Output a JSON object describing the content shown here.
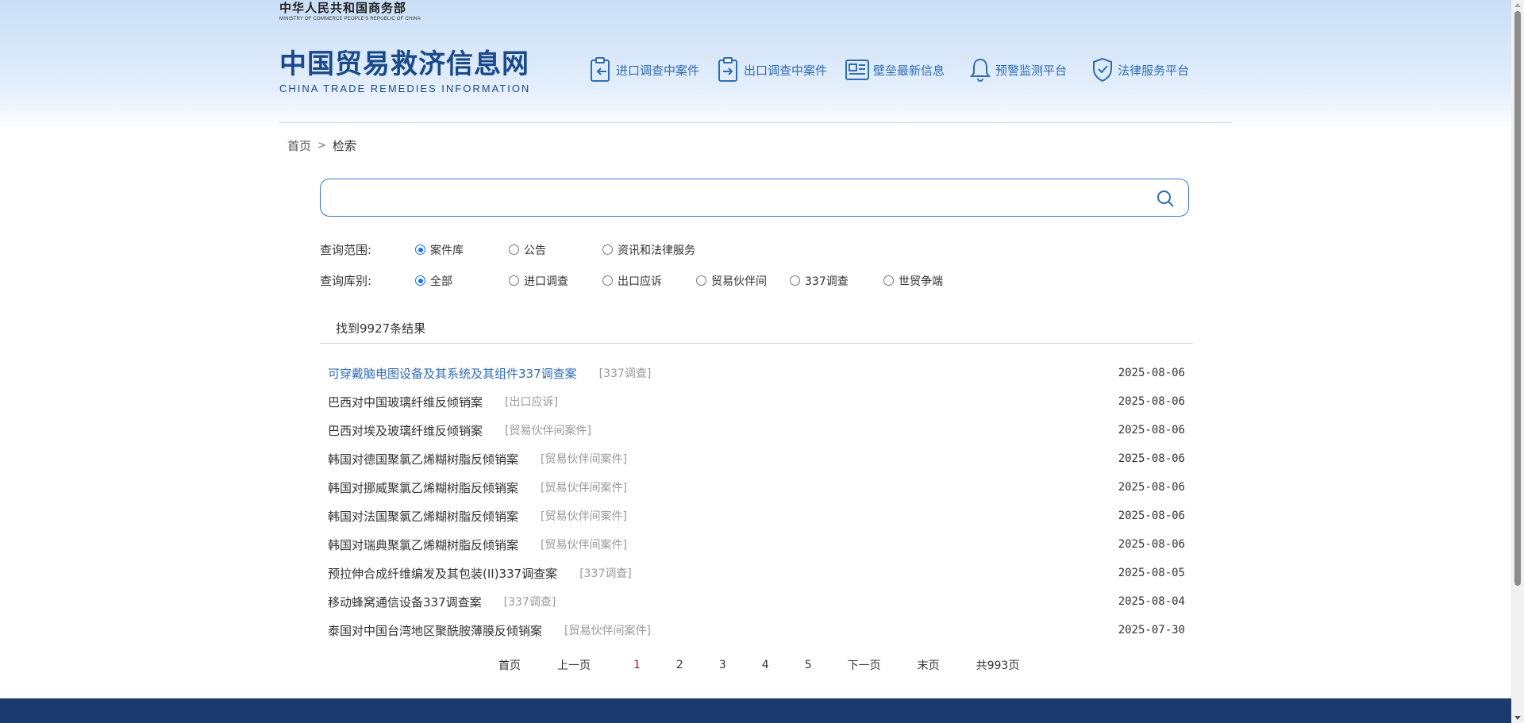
{
  "header": {
    "ministry_cn": "中华人民共和国商务部",
    "ministry_en": "MINISTRY OF COMMERCE PEOPLE'S REPUBLIC OF CHINA",
    "logo_cn": "中国贸易救济信息网",
    "logo_en": "CHINA TRADE REMEDIES INFORMATION",
    "nav": [
      {
        "label": "进口调查中案件",
        "icon": "import-case-icon"
      },
      {
        "label": "出口调查中案件",
        "icon": "export-case-icon"
      },
      {
        "label": "壁垒最新信息",
        "icon": "news-icon"
      },
      {
        "label": "预警监测平台",
        "icon": "bell-icon"
      },
      {
        "label": "法律服务平台",
        "icon": "shield-check-icon"
      }
    ]
  },
  "breadcrumb": {
    "home": "首页",
    "separator": ">",
    "current": "检索"
  },
  "search": {
    "value": "",
    "placeholder": ""
  },
  "filters": {
    "scope_label": "查询范围:",
    "scope_options": [
      "案件库",
      "公告",
      "资讯和法律服务"
    ],
    "scope_selected": "案件库",
    "category_label": "查询库别:",
    "category_options": [
      "全部",
      "进口调查",
      "出口应诉",
      "贸易伙伴间",
      "337调查",
      "世贸争端"
    ],
    "category_selected": "全部"
  },
  "results": {
    "count_text": "找到9927条结果",
    "items": [
      {
        "title": "可穿戴脑电图设备及其系统及其组件337调查案",
        "tag": "[337调查]",
        "date": "2025-08-06"
      },
      {
        "title": "巴西对中国玻璃纤维反倾销案",
        "tag": "[出口应诉]",
        "date": "2025-08-06"
      },
      {
        "title": "巴西对埃及玻璃纤维反倾销案",
        "tag": "[贸易伙伴间案件]",
        "date": "2025-08-06"
      },
      {
        "title": "韩国对德国聚氯乙烯糊树脂反倾销案",
        "tag": "[贸易伙伴间案件]",
        "date": "2025-08-06"
      },
      {
        "title": "韩国对挪威聚氯乙烯糊树脂反倾销案",
        "tag": "[贸易伙伴间案件]",
        "date": "2025-08-06"
      },
      {
        "title": "韩国对法国聚氯乙烯糊树脂反倾销案",
        "tag": "[贸易伙伴间案件]",
        "date": "2025-08-06"
      },
      {
        "title": "韩国对瑞典聚氯乙烯糊树脂反倾销案",
        "tag": "[贸易伙伴间案件]",
        "date": "2025-08-06"
      },
      {
        "title": "预拉伸合成纤维编发及其包装(II)337调查案",
        "tag": "[337调查]",
        "date": "2025-08-05"
      },
      {
        "title": "移动蜂窝通信设备337调查案",
        "tag": "[337调查]",
        "date": "2025-08-04"
      },
      {
        "title": "泰国对中国台湾地区聚酰胺薄膜反倾销案",
        "tag": "[贸易伙伴间案件]",
        "date": "2025-07-30"
      }
    ]
  },
  "pagination": {
    "first": "首页",
    "prev": "上一页",
    "pages": [
      "1",
      "2",
      "3",
      "4",
      "5"
    ],
    "current": "1",
    "next": "下一页",
    "last": "末页",
    "total": "共993页"
  },
  "colors": {
    "brand": "#1a4a8a",
    "link": "#2f6db3",
    "active_page": "#d0021b",
    "footer": "#1b3b6f"
  }
}
